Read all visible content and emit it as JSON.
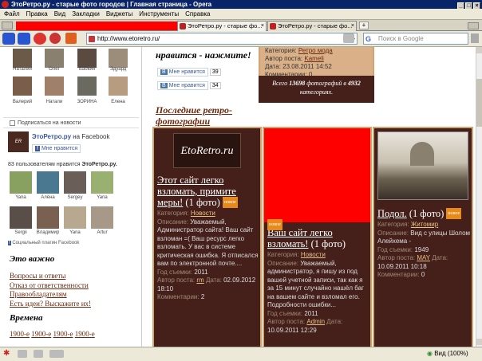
{
  "window": {
    "title": "ЭтоРетро.ру - старые фото городов | Главная страница - Opera"
  },
  "menu": [
    "Файл",
    "Правка",
    "Вид",
    "Закладки",
    "Виджеты",
    "Инструменты",
    "Справка"
  ],
  "tabs": [
    {
      "label": "ЭтоРетро.ру - старые фо..."
    },
    {
      "label": "ЭтоРетро.ру - старые фо..."
    }
  ],
  "address": {
    "url": "http://www.etoretro.ru/",
    "search_placeholder": "Поиск в Google"
  },
  "sidebar": {
    "people_row1": [
      "Наталия",
      "Олег",
      "Бабкин",
      "Эдуард"
    ],
    "people_row2": [
      "Валерий",
      "Натали",
      "ЗОРИНА",
      "Елена"
    ],
    "subscribe_label": "Подписаться на новости",
    "fb_title": "ЭтоРетро.ру",
    "fb_on": "на Facebook",
    "fb_like_button": "Мне нравится",
    "fb_count_text": "83 пользователям нравится",
    "fb_count_site": "ЭтоРетро.ру.",
    "fans_row1": [
      "Yana",
      "Алёна",
      "Sergey",
      "Yana"
    ],
    "fans_row2": [
      "Sergii",
      "Владимир",
      "Yana",
      "Artur"
    ],
    "fb_plugin": "Социальный плагин Facebook",
    "important_heading": "Это важно",
    "links": [
      "Вопросы и ответы",
      "Отказ от ответственности",
      "Правообладателям",
      "Есть идеи? Выскажите их!"
    ],
    "times_heading": "Времена",
    "times_links": [
      "1900-е",
      "1900-е",
      "1900-е",
      "1900-е"
    ]
  },
  "main": {
    "like_prompt": "нравится - нажмите!",
    "like1": {
      "label": "Мне нравится",
      "count": "39"
    },
    "like2": {
      "label": "Мне нравится",
      "count": "34"
    },
    "top_card": {
      "category_label": "Категория:",
      "category": "Ретро мода",
      "author_label": "Автор поста:",
      "author": "Kameli",
      "date_label": "Дата:",
      "date": "23.08.2011 14:52",
      "comments_label": "Комментарии:",
      "comments": "0",
      "total_prefix": "Всего",
      "total_photos": "13698",
      "total_mid": "фотографий в",
      "total_cats": "4932",
      "total_suffix": "категориях."
    },
    "section_title": "Последние ретро-фотографии",
    "cards": [
      {
        "logo": "EtoRetro.ru",
        "title": "Этот сайт легко взломать, примите меры!",
        "count": "(1 фото)",
        "badge": "новое",
        "category_label": "Категория:",
        "category": "Новости",
        "desc_label": "Описание:",
        "desc": "Уважаемый, Администратор сайта! Ваш сайт взломан =( Ваш ресурс легко взломать. У вас в системе критическая ошибка. Я отписался вам по электронной почте....",
        "year_label": "Год съемки:",
        "year": "2011",
        "author_label": "Автор поста:",
        "author": "rm",
        "date_label": "Дата:",
        "date": "02.09.2012 18:10",
        "comments_label": "Комментарии:",
        "comments": "2"
      },
      {
        "title": "Ваш сайт легко взломать!",
        "count": "(1 фото)",
        "badge": "новое",
        "category_label": "Категория:",
        "category": "Новости",
        "desc_label": "Описание:",
        "desc": "Уважаемый, администратор, я пишу из под вашей учетной записи, так как я за 15 минут случайно нашёл баг на вашем сайте и взломал его. Подробности ошибки...",
        "year_label": "Год съемки:",
        "year": "2011",
        "author_label": "Автор поста:",
        "author": "Admin",
        "date_label": "Дата:",
        "date": "10.09.2011 12:29"
      },
      {
        "title": "Подол.",
        "count": "(1 фото)",
        "badge": "новое",
        "category_label": "Категория:",
        "category": "Житомир",
        "desc_label": "Описание:",
        "desc": "Вид с улицы Шолом Алейхема -",
        "year_label": "Год съемки:",
        "year": "1949",
        "author_label": "Автор поста:",
        "author": "MAY",
        "date_label": "Дата:",
        "date": "10.09.2011 10:18",
        "comments_label": "Комментарии:",
        "comments": "0"
      }
    ]
  },
  "status": {
    "zoom": "Вид (100%)"
  },
  "colors": {
    "card_bg": "#45201a",
    "card_border": "#d3a36f",
    "title_bar": "#0a246a",
    "red_block": "#ff0000"
  }
}
